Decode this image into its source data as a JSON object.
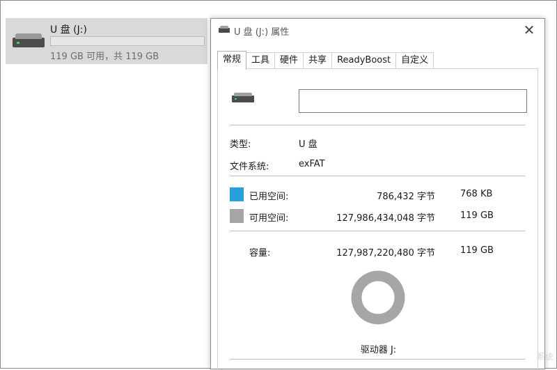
{
  "explorer": {
    "drive_name": "U 盘 (J:)",
    "drive_size": "119 GB 可用，共 119 GB",
    "used_fraction": 0.0
  },
  "dialog": {
    "title": "U 盘 (J:) 属性",
    "close_glyph": "✕",
    "tabs": [
      {
        "label": "常规",
        "active": true
      },
      {
        "label": "工具",
        "active": false
      },
      {
        "label": "硬件",
        "active": false
      },
      {
        "label": "共享",
        "active": false
      },
      {
        "label": "ReadyBoost",
        "active": false
      },
      {
        "label": "自定义",
        "active": false
      }
    ],
    "volume_label_value": "",
    "type_label": "类型:",
    "type_value": "U 盘",
    "fs_label": "文件系统:",
    "fs_value": "exFAT",
    "used_label": "已用空间:",
    "used_bytes": "786,432 字节",
    "used_size": "768 KB",
    "free_label": "可用空间:",
    "free_bytes": "127,986,434,048 字节",
    "free_size": "119 GB",
    "capacity_label": "容量:",
    "capacity_bytes": "127,987,220,480 字节",
    "capacity_size": "119 GB",
    "drive_letter": "驱动器 J:",
    "colors": {
      "used": "#26a0da",
      "free": "#a6a6a6"
    }
  },
  "watermark": "系统"
}
